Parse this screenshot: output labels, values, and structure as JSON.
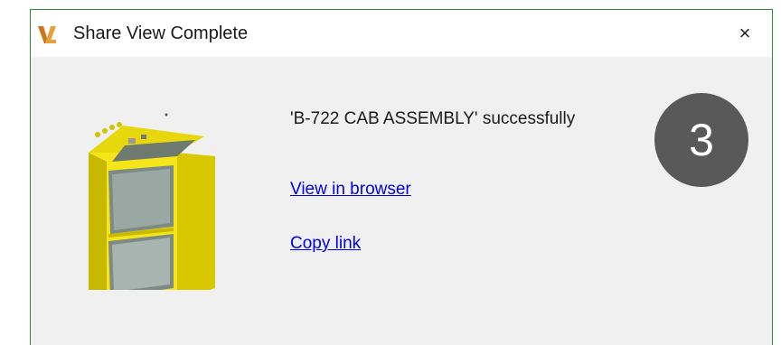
{
  "window": {
    "title": "Share View Complete",
    "close_glyph": "×",
    "app_icon": "vault-logo-icon",
    "accent_color": "#2e8b3a"
  },
  "content": {
    "message": "'B-722 CAB ASSEMBLY' successfully",
    "view_in_browser_label": "View in browser",
    "copy_link_label": "Copy link",
    "thumbnail_icon": "assembly-thumbnail",
    "link_color": "#0000ee"
  },
  "overlay": {
    "step_number": "3",
    "badge_color": "#595959"
  }
}
